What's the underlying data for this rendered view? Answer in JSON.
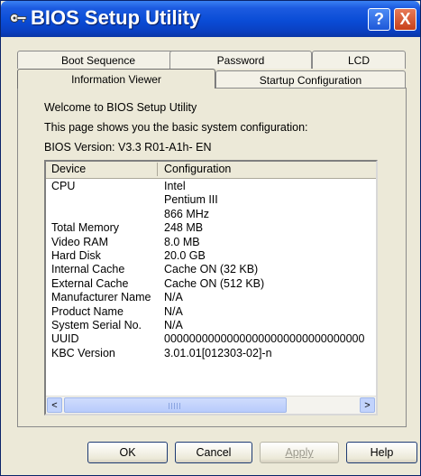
{
  "window": {
    "title": "BIOS Setup Utility",
    "help_glyph": "?",
    "close_glyph": "X"
  },
  "tabs": {
    "boot_sequence": "Boot Sequence",
    "password": "Password",
    "lcd": "LCD",
    "information_viewer": "Information Viewer",
    "startup_configuration": "Startup Configuration",
    "active": "Information Viewer"
  },
  "info": {
    "welcome": "Welcome to BIOS Setup Utility",
    "description": "This page shows you the basic system configuration:",
    "bios_version": "BIOS Version: V3.3 R01-A1h- EN"
  },
  "table": {
    "headers": {
      "device": "Device",
      "configuration": "Configuration"
    },
    "rows": [
      {
        "device": "CPU",
        "value": "Intel"
      },
      {
        "device": "",
        "value": "Pentium III"
      },
      {
        "device": "",
        "value": "866 MHz"
      },
      {
        "device": "Total Memory",
        "value": "248 MB"
      },
      {
        "device": "Video RAM",
        "value": "8.0 MB"
      },
      {
        "device": "Hard Disk",
        "value": "20.0 GB"
      },
      {
        "device": "Internal Cache",
        "value": "Cache ON (32 KB)"
      },
      {
        "device": "External Cache",
        "value": "Cache ON (512 KB)"
      },
      {
        "device": "Manufacturer Name",
        "value": "N/A"
      },
      {
        "device": "Product Name",
        "value": "N/A"
      },
      {
        "device": "System Serial No.",
        "value": "N/A"
      },
      {
        "device": "UUID",
        "value": "00000000000000000000000000000000"
      },
      {
        "device": "KBC Version",
        "value": "3.01.01[012303-02]-n"
      }
    ],
    "scroll_left_glyph": "<",
    "scroll_right_glyph": ">"
  },
  "buttons": {
    "ok": "OK",
    "cancel": "Cancel",
    "apply": "Apply",
    "help": "Help"
  },
  "colors": {
    "titlebar": "#0a4cd6",
    "close_button": "#c8401b",
    "window_face": "#ece9d8"
  },
  "icons": {
    "title": "key-icon",
    "help": "help-icon",
    "close": "close-icon",
    "scroll_left": "arrow-left-icon",
    "scroll_right": "arrow-right-icon"
  }
}
